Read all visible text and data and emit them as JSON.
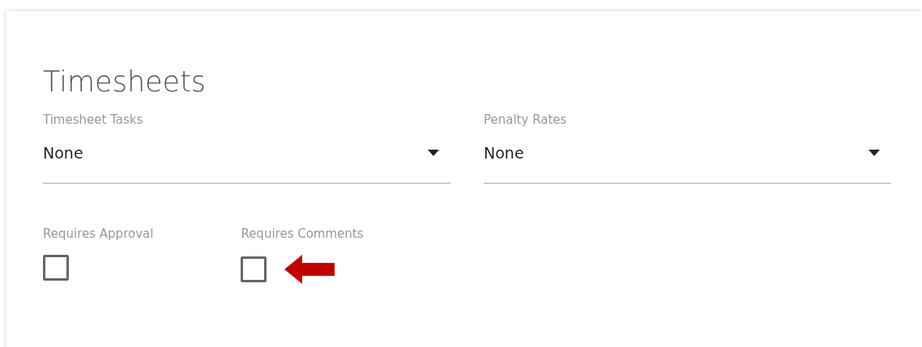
{
  "title": "Timesheets",
  "selects": [
    {
      "label": "Timesheet Tasks",
      "value": "None"
    },
    {
      "label": "Penalty Rates",
      "value": "None"
    }
  ],
  "checkboxes": [
    {
      "label": "Requires Approval",
      "checked": false,
      "annotated": false
    },
    {
      "label": "Requires Comments",
      "checked": false,
      "annotated": true
    }
  ]
}
